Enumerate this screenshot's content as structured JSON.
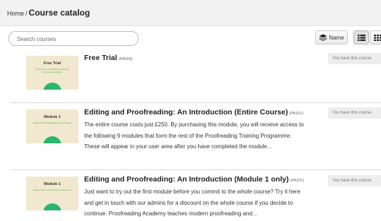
{
  "breadcrumb": {
    "home": "Home",
    "separator": "/",
    "current": "Course catalog"
  },
  "search": {
    "placeholder": "Search courses"
  },
  "toolbar": {
    "sort_label": "Name",
    "sort_icon": "stack-icon",
    "list_view_icon": "list-icon",
    "grid_view_icon": "grid-icon"
  },
  "courses": [
    {
      "title": "Free Trial",
      "code": "(PA000)",
      "description": "",
      "thumbnail": {
        "title": "Free Trial",
        "subtitle": "Extracted from Module 1 Grammar Punctuation Lifestyle"
      },
      "status_label": "You have this course"
    },
    {
      "title": "Editing and Proofreading: An Introduction (Entire Course)",
      "code": "(PA101)",
      "description": "The entire course costs just £250. By purchasing this module, you will receive access to the following 9 modules that form the rest of the Proofreading Training Programme. These will appear in your user area after you have completed the module...",
      "thumbnail": {
        "title": "Module 1",
        "subtitle": "Editing and Proofreading An Introduction"
      },
      "status_label": "You have this course"
    },
    {
      "title": "Editing and Proofreading: An Introduction (Module 1 only)",
      "code": "(PA201)",
      "description": "Just want to try out the first module before you commit to the whole course? Try it here and get in touch with our admins for a discount on the whole course if you decide to continue. Proofreading Academy teaches modern proofreading and...",
      "thumbnail": {
        "title": "Module 1",
        "subtitle": "Editing and Proofreading An Introduction"
      },
      "status_label": "You have this course"
    }
  ]
}
